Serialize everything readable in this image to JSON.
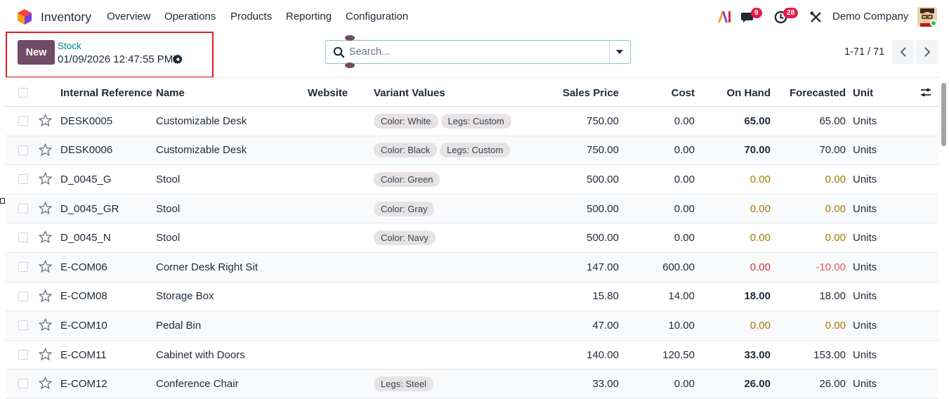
{
  "navbar": {
    "app_name": "Inventory",
    "menu": [
      "Overview",
      "Operations",
      "Products",
      "Reporting",
      "Configuration"
    ],
    "messages_count": "9",
    "activities_count": "28",
    "company": "Demo Company"
  },
  "control_panel": {
    "new_label": "New",
    "breadcrumb_parent": "Stock",
    "breadcrumb_current": "01/09/2026 12:47:55 PM",
    "search_placeholder": "Search...",
    "pager": "1-71 / 71"
  },
  "table": {
    "columns": [
      "Internal Reference",
      "Name",
      "Website",
      "Variant Values",
      "Sales Price",
      "Cost",
      "On Hand",
      "Forecasted",
      "Unit"
    ],
    "rows": [
      {
        "ref": "DESK0005",
        "name": "Customizable Desk",
        "variants": [
          "Color: White",
          "Legs: Custom"
        ],
        "price": "750.00",
        "cost": "0.00",
        "on_hand": "65.00",
        "forecast": "65.00",
        "unit": "Units",
        "state": "ok"
      },
      {
        "ref": "DESK0006",
        "name": "Customizable Desk",
        "variants": [
          "Color: Black",
          "Legs: Custom"
        ],
        "price": "750.00",
        "cost": "0.00",
        "on_hand": "70.00",
        "forecast": "70.00",
        "unit": "Units",
        "state": "ok"
      },
      {
        "ref": "D_0045_G",
        "name": "Stool",
        "variants": [
          "Color: Green"
        ],
        "price": "500.00",
        "cost": "0.00",
        "on_hand": "0.00",
        "forecast": "0.00",
        "unit": "Units",
        "state": "zero"
      },
      {
        "ref": "D_0045_GR",
        "name": "Stool",
        "variants": [
          "Color: Gray"
        ],
        "price": "500.00",
        "cost": "0.00",
        "on_hand": "0.00",
        "forecast": "0.00",
        "unit": "Units",
        "state": "zero"
      },
      {
        "ref": "D_0045_N",
        "name": "Stool",
        "variants": [
          "Color: Navy"
        ],
        "price": "500.00",
        "cost": "0.00",
        "on_hand": "0.00",
        "forecast": "0.00",
        "unit": "Units",
        "state": "zero"
      },
      {
        "ref": "E-COM06",
        "name": "Corner Desk Right Sit",
        "variants": [],
        "price": "147.00",
        "cost": "600.00",
        "on_hand": "0.00",
        "forecast": "-10.00",
        "unit": "Units",
        "state": "negative"
      },
      {
        "ref": "E-COM08",
        "name": "Storage Box",
        "variants": [],
        "price": "15.80",
        "cost": "14.00",
        "on_hand": "18.00",
        "forecast": "18.00",
        "unit": "Units",
        "state": "ok"
      },
      {
        "ref": "E-COM10",
        "name": "Pedal Bin",
        "variants": [],
        "price": "47.00",
        "cost": "10.00",
        "on_hand": "0.00",
        "forecast": "0.00",
        "unit": "Units",
        "state": "zero"
      },
      {
        "ref": "E-COM11",
        "name": "Cabinet with Doors",
        "variants": [],
        "price": "140.00",
        "cost": "120.50",
        "on_hand": "33.00",
        "forecast": "153.00",
        "unit": "Units",
        "state": "ok"
      },
      {
        "ref": "E-COM12",
        "name": "Conference Chair",
        "variants": [
          "Legs: Steel"
        ],
        "price": "33.00",
        "cost": "0.00",
        "on_hand": "26.00",
        "forecast": "26.00",
        "unit": "Units",
        "state": "ok"
      }
    ]
  },
  "icons": {
    "app_logo": "inventory-logo-icon",
    "ai": "ai-icon",
    "messages": "chat-icon",
    "activities": "clock-icon",
    "debug": "tools-icon",
    "gear": "gear-icon",
    "search": "search-icon",
    "star": "star-icon",
    "optional_columns": "sliders-icon"
  },
  "colors": {
    "brand": "#714b67",
    "link": "#017e84",
    "warning": "#a37a00",
    "danger": "#d63031",
    "highlight": "#e11d24"
  }
}
